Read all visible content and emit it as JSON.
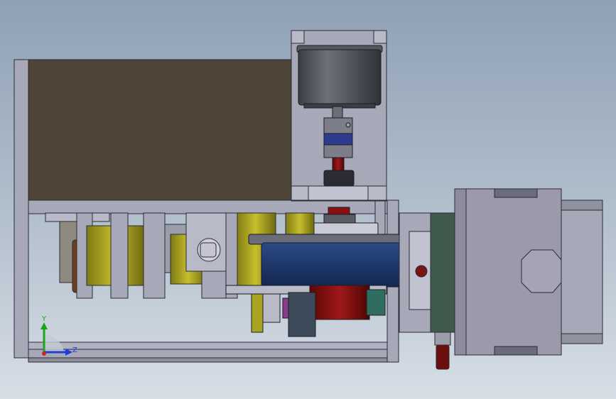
{
  "view": {
    "triad": {
      "y_label": "Y",
      "z_label": "Z",
      "y_color": "#1aa51a",
      "z_color": "#1f3cd6",
      "x_color": "#d61f1f"
    }
  },
  "colors": {
    "frame_gray": "#a8a9b8",
    "frame_edge": "#2b2b36",
    "panel_brown": "#4e4437",
    "motor_dark": "#4a4d55",
    "coupling_blue": "#2e3b8c",
    "shaft_red": "#8a1010",
    "pulley_blue": "#1d3a73",
    "block_yellow": "#a9a321",
    "gearbox_gray": "#9c9aaa",
    "green_plate": "#3f5a4c"
  }
}
